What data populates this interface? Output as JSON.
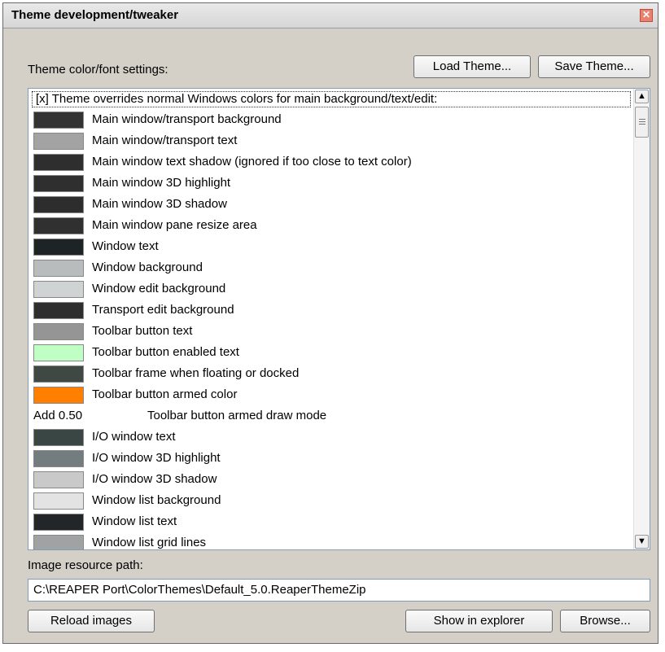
{
  "window": {
    "title": "Theme development/tweaker",
    "close_glyph": "✕"
  },
  "color_section": {
    "label": "Theme color/font settings:",
    "load_label": "Load Theme...",
    "save_label": "Save Theme...",
    "header": "[x] Theme overrides normal Windows colors for main background/text/edit:",
    "items": [
      {
        "label": "Main window/transport background",
        "color": "#333333"
      },
      {
        "label": "Main window/transport text",
        "color": "#a3a3a3"
      },
      {
        "label": "Main window text shadow (ignored if too close to text color)",
        "color": "#2e2e2e"
      },
      {
        "label": "Main window 3D highlight",
        "color": "#2f2f2f"
      },
      {
        "label": "Main window 3D shadow",
        "color": "#2d2d2d"
      },
      {
        "label": "Main window pane resize area",
        "color": "#303030"
      },
      {
        "label": "Window text",
        "color": "#1e2425"
      },
      {
        "label": "Window background",
        "color": "#b8bcbd"
      },
      {
        "label": "Window edit background",
        "color": "#d0d3d4"
      },
      {
        "label": "Transport edit background",
        "color": "#2e2e2e"
      },
      {
        "label": "Toolbar button text",
        "color": "#959595"
      },
      {
        "label": "Toolbar button enabled text",
        "color": "#bfffc4"
      },
      {
        "label": "Toolbar frame when floating or docked",
        "color": "#3f4843"
      },
      {
        "label": "Toolbar button armed color",
        "color": "#ff7f00"
      },
      {
        "mode_value": "Add 0.50",
        "label": "Toolbar button armed draw mode"
      },
      {
        "label": "I/O window text",
        "color": "#3a4644"
      },
      {
        "label": "I/O window 3D highlight",
        "color": "#737c7e"
      },
      {
        "label": "I/O window 3D shadow",
        "color": "#c9c9c9"
      },
      {
        "label": "Window list background",
        "color": "#e3e3e3"
      },
      {
        "label": "Window list text",
        "color": "#232628"
      },
      {
        "label": "Window list grid lines",
        "color": "#9fa3a4"
      }
    ]
  },
  "scroll": {
    "up_glyph": "▲",
    "down_glyph": "▼"
  },
  "path_section": {
    "label": "Image resource path:",
    "value": "C:\\REAPER Port\\ColorThemes\\Default_5.0.ReaperThemeZip"
  },
  "bottom_buttons": {
    "reload_label": "Reload images",
    "explorer_label": "Show in explorer",
    "browse_label": "Browse..."
  }
}
